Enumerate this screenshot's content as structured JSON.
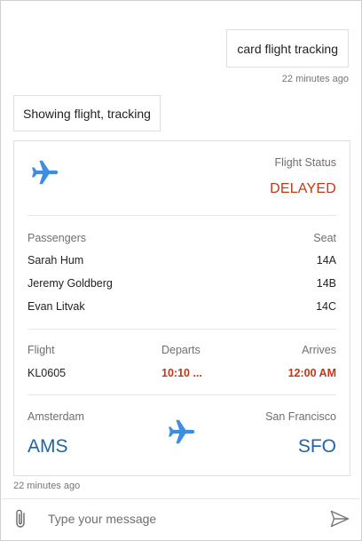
{
  "chat": {
    "user_message": "card flight tracking",
    "user_timestamp": "22 minutes ago",
    "bot_message": "Showing flight, tracking",
    "bot_timestamp": "22 minutes ago"
  },
  "card": {
    "icon": "airplane-icon",
    "status_label": "Flight Status",
    "status_value": "DELAYED",
    "passengers_label": "Passengers",
    "seat_label": "Seat",
    "passengers": [
      {
        "name": "Sarah Hum",
        "seat": "14A"
      },
      {
        "name": "Jeremy Goldberg",
        "seat": "14B"
      },
      {
        "name": "Evan Litvak",
        "seat": "14C"
      }
    ],
    "flight_label": "Flight",
    "departs_label": "Departs",
    "arrives_label": "Arrives",
    "flight_number": "KL0605",
    "departs_time": "10:10 ...",
    "arrives_time": "12:00 AM",
    "origin_city": "Amsterdam",
    "origin_code": "AMS",
    "destination_city": "San Francisco",
    "destination_code": "SFO"
  },
  "composer": {
    "placeholder": "Type your message",
    "attach_icon": "paperclip-icon",
    "send_icon": "send-icon"
  },
  "colors": {
    "accent_blue": "#1e64a8",
    "icon_blue": "#3c8fe0",
    "delayed_red": "#c0381a"
  }
}
